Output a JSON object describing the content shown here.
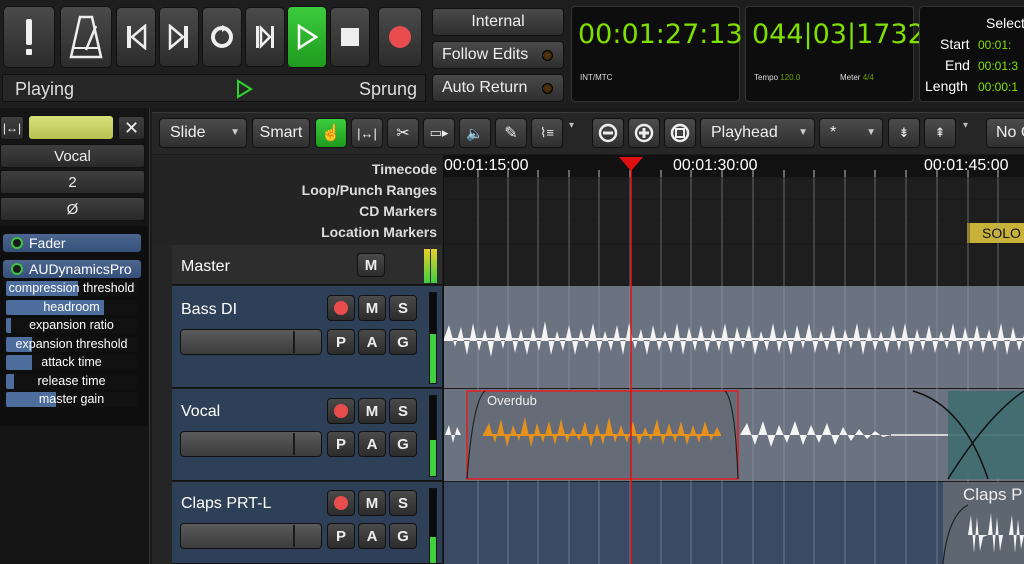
{
  "transport": {
    "status_left": "Playing",
    "status_right": "Sprung",
    "buttons": [
      "panic",
      "metronome",
      "goto-start",
      "goto-end",
      "loop",
      "play-range",
      "play",
      "stop",
      "record"
    ]
  },
  "sync": {
    "internal_label": "Internal",
    "follow_edits_label": "Follow Edits",
    "auto_return_label": "Auto Return"
  },
  "clock_primary": {
    "value": "00:01:27:13",
    "sub": "INT/MTC"
  },
  "clock_secondary": {
    "value": "044|03|1732",
    "tempo_label": "Tempo",
    "tempo_value": "120.0",
    "meter_label": "Meter",
    "meter_value": "4/4"
  },
  "selection": {
    "title": "Select",
    "start_label": "Start",
    "start_value": "00:01:",
    "end_label": "End",
    "end_value": "00:01:3",
    "length_label": "Length",
    "length_value": "00:00:1"
  },
  "toolbar": {
    "edit_mode": "Slide",
    "smart_label": "Smart",
    "edit_point": "Playhead",
    "grid": "*",
    "no_label": "No C"
  },
  "mixer_strip": {
    "name": "Vocal",
    "input": "2",
    "phase": "Ø",
    "plugins": [
      "Fader",
      "AUDynamicsPro"
    ],
    "params": [
      {
        "label": "compression threshold",
        "level": 0.55
      },
      {
        "label": "headroom",
        "level": 0.75
      },
      {
        "label": "expansion ratio",
        "level": 0.04
      },
      {
        "label": "expansion threshold",
        "level": 0.2
      },
      {
        "label": "attack time",
        "level": 0.2
      },
      {
        "label": "release time",
        "level": 0.06
      },
      {
        "label": "master gain",
        "level": 0.38
      }
    ]
  },
  "rulers": {
    "labels": [
      "Timecode",
      "Loop/Punch Ranges",
      "CD Markers",
      "Location Markers"
    ],
    "timecode_ticks": [
      "00:01:15:00",
      "00:01:30:00",
      "00:01:45:00"
    ],
    "marker": "SOLO"
  },
  "tracks": [
    {
      "name": "Master",
      "buttons": [
        "M"
      ]
    },
    {
      "name": "Bass DI",
      "buttons_top": [
        "M",
        "S"
      ],
      "buttons_bottom": [
        "P",
        "A",
        "G"
      ]
    },
    {
      "name": "Vocal",
      "buttons_top": [
        "M",
        "S"
      ],
      "buttons_bottom": [
        "P",
        "A",
        "G"
      ],
      "region": "Overdub"
    },
    {
      "name": "Claps PRT-L",
      "buttons_top": [
        "M",
        "S"
      ],
      "buttons_bottom": [
        "P",
        "A",
        "G"
      ],
      "region": "Claps P"
    }
  ],
  "colors": {
    "clock_green": "#7fe000",
    "track_header": "#2e4058",
    "region_selected": "#e6921a",
    "playhead": "#e01010",
    "play_active": "#2bb22b"
  }
}
